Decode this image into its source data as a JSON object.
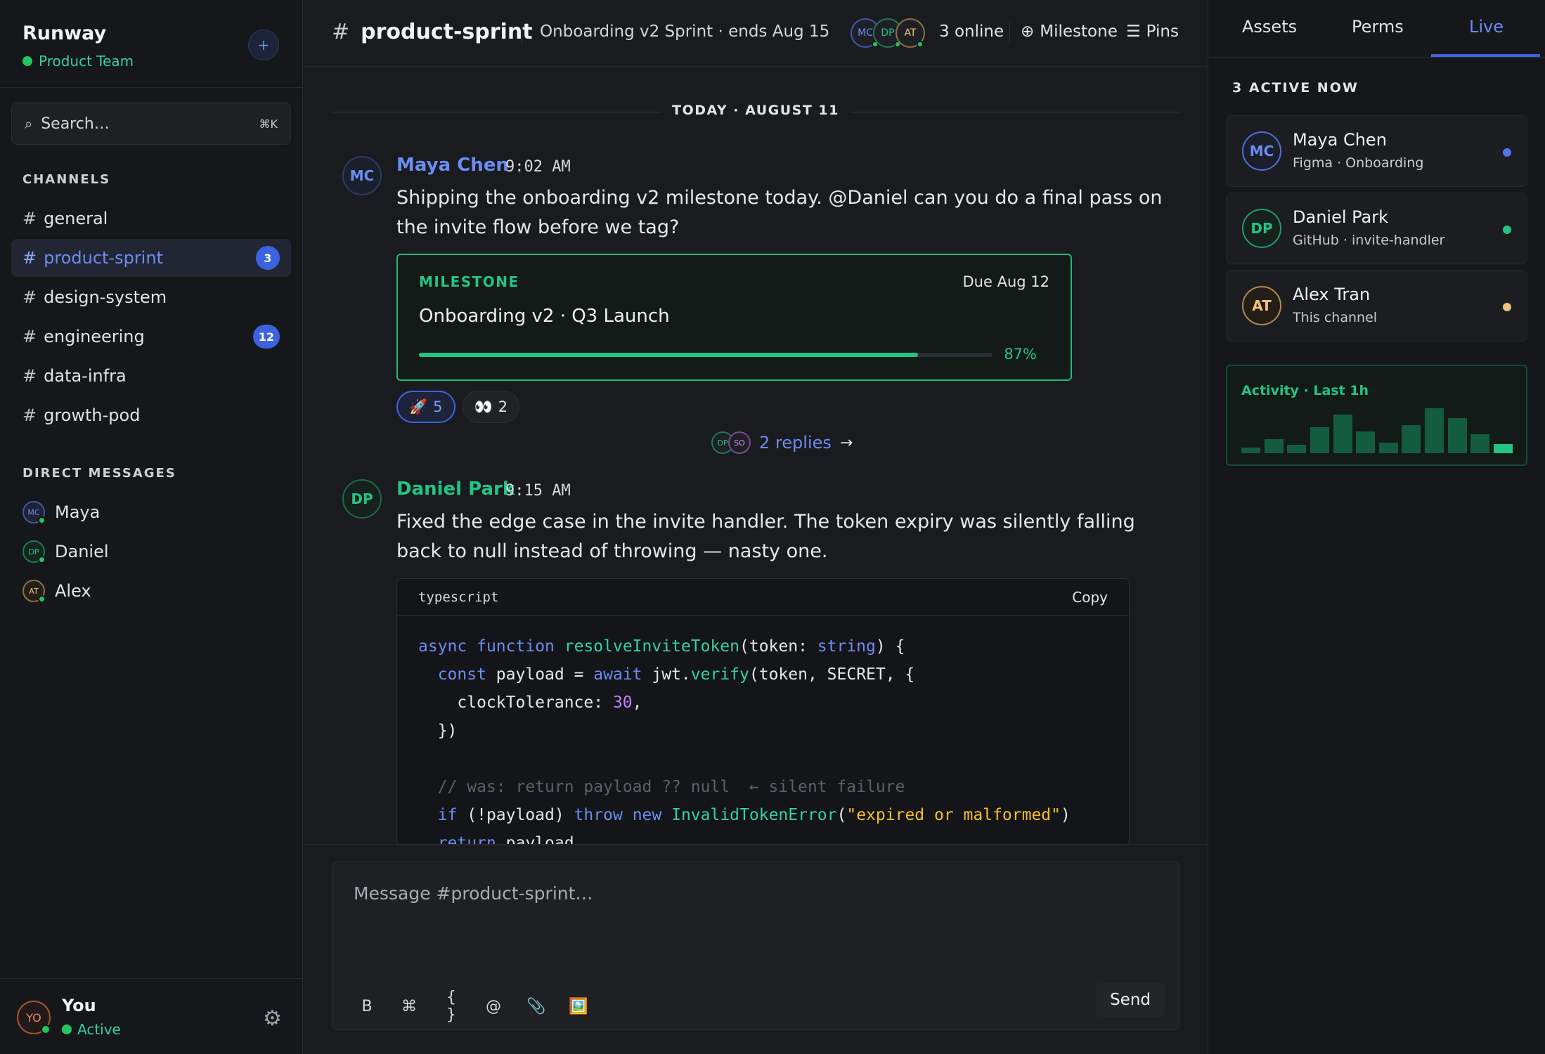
{
  "workspace": {
    "name": "Runway",
    "team": "Product Team",
    "add_label": "+"
  },
  "search": {
    "placeholder": "Search…",
    "shortcut": "⌘K",
    "icon": "search-icon"
  },
  "channels": {
    "label": "CHANNELS",
    "items": [
      {
        "name": "general",
        "badge": ""
      },
      {
        "name": "product-sprint",
        "badge": "3",
        "active": true
      },
      {
        "name": "design-system",
        "badge": ""
      },
      {
        "name": "engineering",
        "badge": "12"
      },
      {
        "name": "data-infra",
        "badge": ""
      },
      {
        "name": "growth-pod",
        "badge": ""
      }
    ]
  },
  "dms": {
    "label": "DIRECT MESSAGES",
    "items": [
      {
        "initials": "MC",
        "name": "Maya",
        "color": "#6b8cf0"
      },
      {
        "initials": "DP",
        "name": "Daniel",
        "color": "#22c584"
      },
      {
        "initials": "AT",
        "name": "Alex",
        "color": "#f0c27b"
      }
    ]
  },
  "me": {
    "initials": "YO",
    "name": "You",
    "status": "Active"
  },
  "header": {
    "hash": "#",
    "channel": "product-sprint",
    "subtitle": "Onboarding v2 Sprint · ends Aug 15",
    "avatars": [
      "MC",
      "DP",
      "AT"
    ],
    "online": "3 online",
    "milestone_btn": "Milestone",
    "pins_btn": "Pins"
  },
  "day_separator": "TODAY · AUGUST 11",
  "messages": [
    {
      "initials": "MC",
      "author": "Maya Chen",
      "time": "9:02 AM",
      "text": "Shipping the onboarding v2 milestone today. @Daniel can you do a final pass on the invite flow before we tag?",
      "color": "#6b8cf0"
    },
    {
      "initials": "DP",
      "author": "Daniel Park",
      "time": "9:15 AM",
      "text": "Fixed the edge case in the invite handler. The token expiry was silently falling back to null instead of throwing — nasty one.",
      "color": "#22c584"
    }
  ],
  "milestone": {
    "label": "MILESTONE",
    "due": "Due Aug 12",
    "title": "Onboarding v2 · Q3 Launch",
    "progress": 0.87,
    "progress_label": "87%"
  },
  "reactions": [
    {
      "emoji": "🚀",
      "count": "5",
      "mine": true
    },
    {
      "emoji": "👀",
      "count": "2",
      "mine": false
    }
  ],
  "replies": {
    "avatars": [
      "DP",
      "SO"
    ],
    "text": "2 replies",
    "arrow": "→"
  },
  "code": {
    "language": "typescript",
    "copy_label": "Copy"
  },
  "composer": {
    "placeholder": "Message #product-sprint…",
    "tools": [
      {
        "icon": "bold-icon",
        "glyph": "B"
      },
      {
        "icon": "command-icon",
        "glyph": "⌘"
      },
      {
        "icon": "code-braces-icon",
        "glyph": "{ }"
      },
      {
        "icon": "mention-icon",
        "glyph": "@"
      },
      {
        "icon": "attachment-icon",
        "glyph": "📎"
      },
      {
        "icon": "image-icon",
        "glyph": "🖼️"
      }
    ],
    "send_label": "Send"
  },
  "right_panel": {
    "tabs": [
      "Assets",
      "Perms",
      "Live"
    ],
    "active_tab": "Live",
    "active_header": "3 ACTIVE NOW",
    "people": [
      {
        "initials": "MC",
        "name": "Maya Chen",
        "sub": "Figma · Onboarding",
        "color": "#6b8cf0",
        "status_color": "#4f74e8"
      },
      {
        "initials": "DP",
        "name": "Daniel Park",
        "sub": "GitHub · invite-handler",
        "color": "#22c584",
        "status_color": "#22c584"
      },
      {
        "initials": "AT",
        "name": "Alex Tran",
        "sub": "This channel",
        "color": "#f0c27b",
        "status_color": "#f0c27b"
      }
    ],
    "activity": {
      "title": "Activity · Last 1h",
      "levels": [
        0.12,
        0.32,
        0.18,
        0.58,
        0.86,
        0.48,
        0.24,
        0.62,
        1.0,
        0.78,
        0.42,
        0.2
      ]
    }
  }
}
